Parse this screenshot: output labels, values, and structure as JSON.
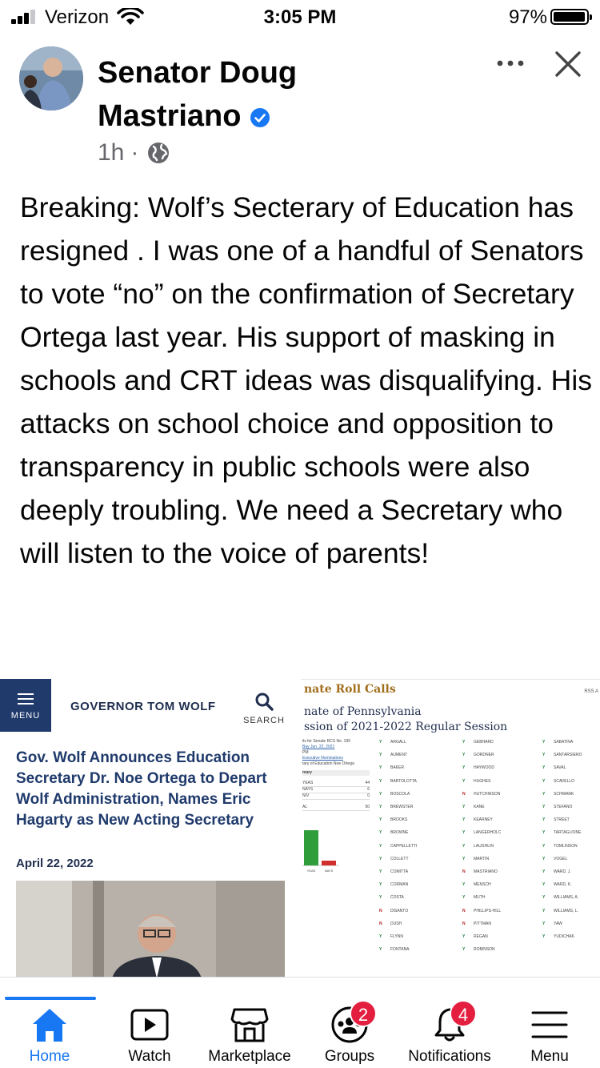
{
  "status_bar": {
    "carrier": "Verizon",
    "time": "3:05 PM",
    "battery_percent": "97%",
    "signal_bars": 3,
    "battery_level": 0.97
  },
  "post": {
    "author_line1": "Senator Doug",
    "author_line2": "Mastriano",
    "verified": true,
    "time_ago": "1h",
    "separator": "·",
    "audience_icon": "globe-icon",
    "body": "Breaking: Wolf’s Secterary of Education has resigned . I was one of a handful of Senators to vote “no” on the confirmation of Secretary Ortega last year. His support of masking in schools and CRT ideas was disqualifying. His attacks on school choice and opposition to transparency in public schools were also deeply troubling. We need a Secretary who will listen to the voice of parents!",
    "more_icon": "more-options-icon",
    "close_icon": "close-icon"
  },
  "attachment_left": {
    "menu_label": "MENU",
    "site_title": "GOVERNOR TOM WOLF",
    "search_label": "SEARCH",
    "headline": "Gov. Wolf Announces Education Secretary Dr. Noe Ortega to Depart Wolf Administration, Names Eric Hagarty as New Acting Secretary",
    "date": "April 22, 2022"
  },
  "attachment_right": {
    "title": "nate Roll Calls",
    "rss": "RSS A",
    "subtitle1": "nate of Pennsylvania",
    "subtitle2": "ssion of 2021-2022 Regular Session",
    "sidebar_lines": [
      "ils for Senate RCS No. 195",
      "Bay Jun. 22, 2021",
      "PM",
      "Executive Nominations",
      "tary of Education Noe Ortega",
      "mary"
    ],
    "tally": [
      {
        "label": "YEAS",
        "value": "44"
      },
      {
        "label": "NAYS",
        "value": "6"
      },
      {
        "label": "N/V",
        "value": "0"
      },
      {
        "label": "AL",
        "value": "50"
      }
    ],
    "chart_labels": [
      "YEAS",
      "NAYS"
    ],
    "chart_values": [
      44,
      6
    ],
    "columns": [
      [
        {
          "vote": "Y",
          "name": "ARGALL"
        },
        {
          "vote": "Y",
          "name": "AUMENT"
        },
        {
          "vote": "Y",
          "name": "BAKER"
        },
        {
          "vote": "Y",
          "name": "BARTOLOTTA"
        },
        {
          "vote": "Y",
          "name": "BOSCOLA"
        },
        {
          "vote": "Y",
          "name": "BREWSTER"
        },
        {
          "vote": "Y",
          "name": "BROOKS"
        },
        {
          "vote": "Y",
          "name": "BROWNE"
        },
        {
          "vote": "Y",
          "name": "CAPPELLETTI"
        },
        {
          "vote": "Y",
          "name": "COLLETT"
        },
        {
          "vote": "Y",
          "name": "COMITTA"
        },
        {
          "vote": "Y",
          "name": "CORMAN"
        },
        {
          "vote": "Y",
          "name": "COSTA"
        },
        {
          "vote": "N",
          "name": "DISANTO"
        },
        {
          "vote": "N",
          "name": "DUSH"
        },
        {
          "vote": "Y",
          "name": "FLYNN"
        },
        {
          "vote": "Y",
          "name": "FONTANA"
        }
      ],
      [
        {
          "vote": "Y",
          "name": "GEBHARD"
        },
        {
          "vote": "Y",
          "name": "GORDNER"
        },
        {
          "vote": "Y",
          "name": "HAYWOOD"
        },
        {
          "vote": "Y",
          "name": "HUGHES"
        },
        {
          "vote": "N",
          "name": "HUTCHINSON"
        },
        {
          "vote": "Y",
          "name": "KANE"
        },
        {
          "vote": "Y",
          "name": "KEARNEY"
        },
        {
          "vote": "Y",
          "name": "LANGERHOLC"
        },
        {
          "vote": "Y",
          "name": "LAUGHLIN"
        },
        {
          "vote": "Y",
          "name": "MARTIN"
        },
        {
          "vote": "N",
          "name": "MASTRIANO"
        },
        {
          "vote": "Y",
          "name": "MENSCH"
        },
        {
          "vote": "Y",
          "name": "MUTH"
        },
        {
          "vote": "N",
          "name": "PHILLIPS-HILL"
        },
        {
          "vote": "N",
          "name": "PITTMAN"
        },
        {
          "vote": "Y",
          "name": "REGAN"
        },
        {
          "vote": "Y",
          "name": "ROBINSON"
        }
      ],
      [
        {
          "vote": "Y",
          "name": "SABATINA"
        },
        {
          "vote": "Y",
          "name": "SANTARSIERO"
        },
        {
          "vote": "Y",
          "name": "SAVAL"
        },
        {
          "vote": "Y",
          "name": "SCAVELLO"
        },
        {
          "vote": "Y",
          "name": "SCHWANK"
        },
        {
          "vote": "Y",
          "name": "STEFANO"
        },
        {
          "vote": "Y",
          "name": "STREET"
        },
        {
          "vote": "Y",
          "name": "TARTAGLIONE"
        },
        {
          "vote": "Y",
          "name": "TOMLINSON"
        },
        {
          "vote": "Y",
          "name": "VOGEL"
        },
        {
          "vote": "Y",
          "name": "WARD, J."
        },
        {
          "vote": "Y",
          "name": "WARD, K."
        },
        {
          "vote": "Y",
          "name": "WILLIAMS, A."
        },
        {
          "vote": "Y",
          "name": "WILLIAMS, L."
        },
        {
          "vote": "Y",
          "name": "YAW"
        },
        {
          "vote": "Y",
          "name": "YUDICHAK"
        }
      ]
    ]
  },
  "bottom_nav": {
    "items": [
      {
        "label": "Home",
        "icon": "home-icon",
        "active": true
      },
      {
        "label": "Watch",
        "icon": "watch-icon",
        "active": false
      },
      {
        "label": "Marketplace",
        "icon": "marketplace-icon",
        "active": false
      },
      {
        "label": "Groups",
        "icon": "groups-icon",
        "active": false,
        "badge": "2"
      },
      {
        "label": "Notifications",
        "icon": "bell-icon",
        "active": false,
        "badge": "4"
      },
      {
        "label": "Menu",
        "icon": "menu-icon",
        "active": false
      }
    ]
  },
  "colors": {
    "accent": "#1877f2",
    "badge": "#e41e3f",
    "text": "#050505",
    "secondary_text": "#65676b"
  }
}
